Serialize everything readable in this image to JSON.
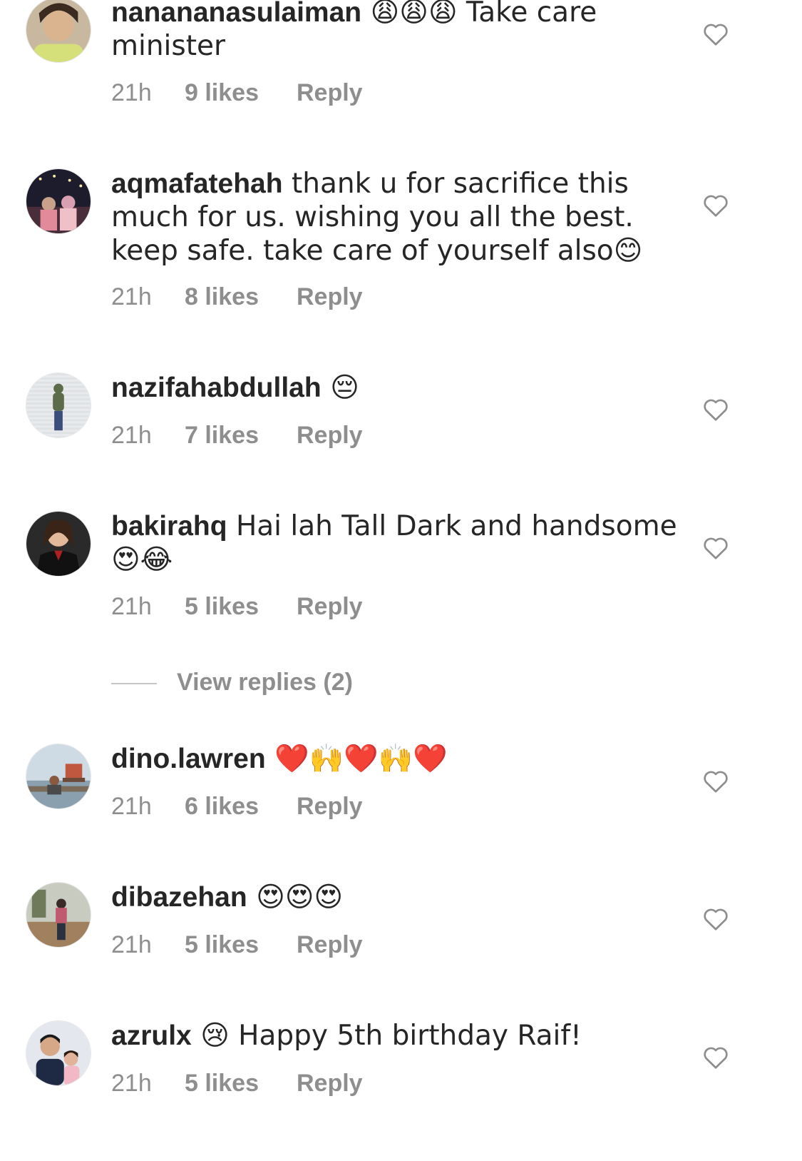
{
  "comments": [
    {
      "username": "nanananasulaiman",
      "text": " 😩😩😩 Take care minister",
      "time": "21h",
      "likes": "9 likes",
      "reply": "Reply"
    },
    {
      "username": "aqmafatehah",
      "text": " thank u for sacrifice this much for us. wishing you all the best. keep safe. take care of yourself also😊",
      "time": "21h",
      "likes": "8 likes",
      "reply": "Reply"
    },
    {
      "username": "nazifahabdullah",
      "text": " 😔",
      "time": "21h",
      "likes": "7 likes",
      "reply": "Reply"
    },
    {
      "username": "bakirahq",
      "text": " Hai lah Tall Dark and handsome\n😍😂",
      "time": "21h",
      "likes": "5 likes",
      "reply": "Reply"
    },
    {
      "username": "dino.lawren",
      "text": " ❤️🙌❤️🙌❤️",
      "time": "21h",
      "likes": "6 likes",
      "reply": "Reply"
    },
    {
      "username": "dibazehan",
      "text": " 😍😍😍",
      "time": "21h",
      "likes": "5 likes",
      "reply": "Reply"
    },
    {
      "username": "azrulx",
      "text": " 😢 Happy 5th birthday Raif!",
      "time": "21h",
      "likes": "5 likes",
      "reply": "Reply"
    }
  ],
  "view_replies": "View replies (2)",
  "icons": {
    "like": "heart-outline-icon"
  },
  "colors": {
    "text": "#262626",
    "secondary": "#8e8e8e",
    "divider": "#c7c7c7",
    "background": "#ffffff"
  }
}
